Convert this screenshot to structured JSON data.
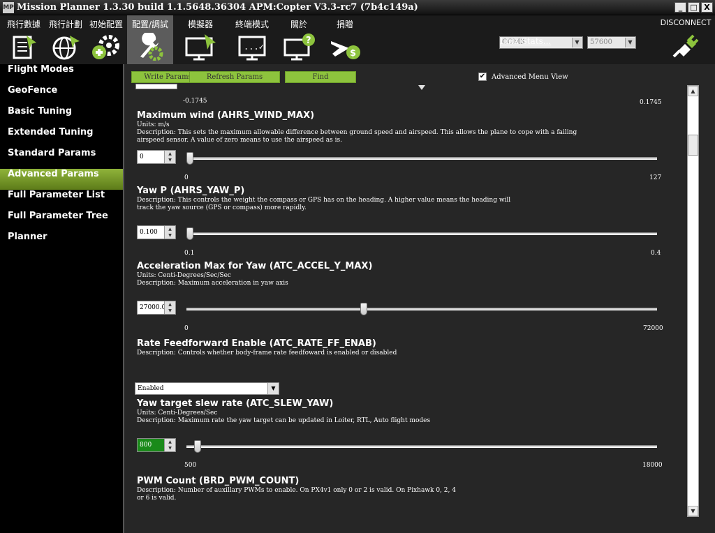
{
  "window": {
    "title": "Mission Planner 1.3.30 build 1.1.5648.36304 APM:Copter V3.3-rc7 (7b4c149a)",
    "app_icon": "MP",
    "btn_min": "_",
    "btn_max": "□",
    "btn_close": "X"
  },
  "menu": [
    {
      "label": "飛行數據",
      "icon": "flight-data-icon"
    },
    {
      "label": "飛行計劃",
      "icon": "flight-plan-icon"
    },
    {
      "label": "初始配置",
      "icon": "initial-setup-icon"
    },
    {
      "label": "配置/調試",
      "icon": "config-tuning-icon"
    },
    {
      "label": "模擬器",
      "icon": "simulation-icon"
    },
    {
      "label": "終端模式",
      "icon": "terminal-icon"
    },
    {
      "label": "關於",
      "icon": "help-icon"
    },
    {
      "label": "捐贈",
      "icon": "donate-icon"
    }
  ],
  "connection": {
    "port": "COM3",
    "baud": "57600",
    "link_stats": "Link Stats...",
    "disconnect_label": "DISCONNECT"
  },
  "sidebar": {
    "items": [
      {
        "label": "Flight Modes"
      },
      {
        "label": "GeoFence"
      },
      {
        "label": "Basic Tuning"
      },
      {
        "label": "Extended Tuning"
      },
      {
        "label": "Standard Params"
      },
      {
        "label": "Advanced Params"
      },
      {
        "label": "Full Parameter List"
      },
      {
        "label": "Full Parameter Tree"
      },
      {
        "label": "Planner"
      }
    ],
    "active": "Advanced Params"
  },
  "toolbar": {
    "write": "Write Params",
    "refresh": "Refresh Params",
    "find": "Find",
    "advanced_view": "Advanced Menu View",
    "advanced_checked": "✔"
  },
  "top_partial": {
    "min": "-0.1745",
    "max": "0.1745"
  },
  "params": [
    {
      "title": "Maximum wind (AHRS_WIND_MAX)",
      "units": "Units: m/s",
      "desc": "Description: This sets the maximum allowable difference between ground speed and airspeed. This allows the plane to cope with a failing airspeed sensor. A value of zero means to use the airspeed as is.",
      "value": "0",
      "min": "0",
      "max": "127",
      "level": 0.0
    },
    {
      "title": "Yaw P (AHRS_YAW_P)",
      "desc": "Description: This controls the weight the compass or GPS has on the heading. A higher value means the heading will track the yaw source (GPS or compass) more rapidly.",
      "value": "0.100",
      "min": "0.1",
      "max": "0.4",
      "level": 0.0
    },
    {
      "title": "Acceleration Max for Yaw (ATC_ACCEL_Y_MAX)",
      "units": "Units: Centi-Degrees/Sec/Sec",
      "desc": "Description: Maximum acceleration in yaw axis",
      "value": "27000.0",
      "min": "0",
      "max": "72000",
      "level": 0.375
    },
    {
      "title": "Rate Feedforward Enable (ATC_RATE_FF_ENAB)",
      "desc": "Description: Controls whether body-frame rate feedfoward is enabled or disabled",
      "selected": "Enabled"
    },
    {
      "title": "Yaw target slew rate (ATC_SLEW_YAW)",
      "units": "Units: Centi-Degrees/Sec",
      "desc": "Description: Maximum rate the yaw target can be updated in Loiter, RTL, Auto flight modes",
      "value": "800",
      "min": "500",
      "max": "18000",
      "level": 0.017
    },
    {
      "title": "PWM Count (BRD_PWM_COUNT)",
      "desc": "Description: Number of auxillary PWMs to enable. On PX4v1 only 0 or 2 is valid. On Pixhawk 0, 2, 4 or 6 is valid."
    }
  ],
  "colors": {
    "accent": "#8dc33d",
    "sidebar_active": "#6f9323",
    "background": "#262626"
  }
}
